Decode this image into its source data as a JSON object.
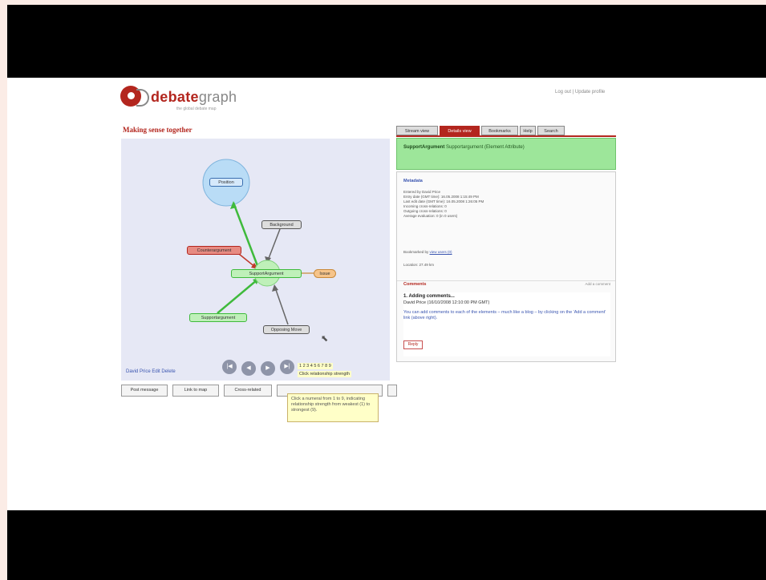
{
  "logo": {
    "brand_a": "debate",
    "brand_b": "graph",
    "tagline": "the global debate map"
  },
  "top_link": "Log out | Update profile",
  "map": {
    "title": "Making sense together",
    "nodes": {
      "position": "Position",
      "background": "Background",
      "counter": "Counterargument",
      "support": "SupportArgument",
      "issue": "Issue",
      "supporting": "Supportargument",
      "opposing": "Opposing Move"
    },
    "links": "David Price Edit Delete",
    "nav": [
      "|◀",
      "◀",
      "▶",
      "▶|"
    ],
    "strength_numerals": "1 2 3 4 5 6 7 8 9",
    "strength_label": "Click relationship strength",
    "buttons": [
      "Post message",
      "Link to map",
      "Cross-related",
      "",
      ""
    ],
    "tooltip": "Click a numeral from 1 to 9, indicating relationship strength from weakest (1) to strongest (9)."
  },
  "tabs": [
    "Stream view",
    "Details view",
    "Bookmarks",
    "Help",
    "Search"
  ],
  "summary": {
    "title": "SupportArgument",
    "text": "Supportargument (Element Attribute)"
  },
  "metadata": {
    "title": "Metadata",
    "lines": [
      "Entered by David Price",
      "Entry date (GMT time): 16.05.2008 1:15:49 PM",
      "Last edit date (GMT time): 16.05.2008 1:26:05 PM",
      "Incoming cross-relations: 0",
      "Outgoing cross-relations: 0",
      "Average evaluation: 0 (in 0 users)"
    ],
    "author": "David Price",
    "bookmarks_label": "Bookmarked by",
    "bookmarks_link": "view users (0)",
    "location": "Location: 27.49 km"
  },
  "comments": {
    "title": "Comments",
    "add": "Add a comment",
    "item_title": "1. Adding comments...",
    "item_author": "David Price (16/10/2008 12:10:00 PM GMT)",
    "item_body": "You can add comments to each of the elements – much like a blog – by clicking on the 'Add a comment' link (above right).",
    "reply": "Reply"
  },
  "colors": {
    "accent": "#b3261e",
    "map_bg": "#e6e8f5",
    "summary_bg": "#9de69a"
  }
}
